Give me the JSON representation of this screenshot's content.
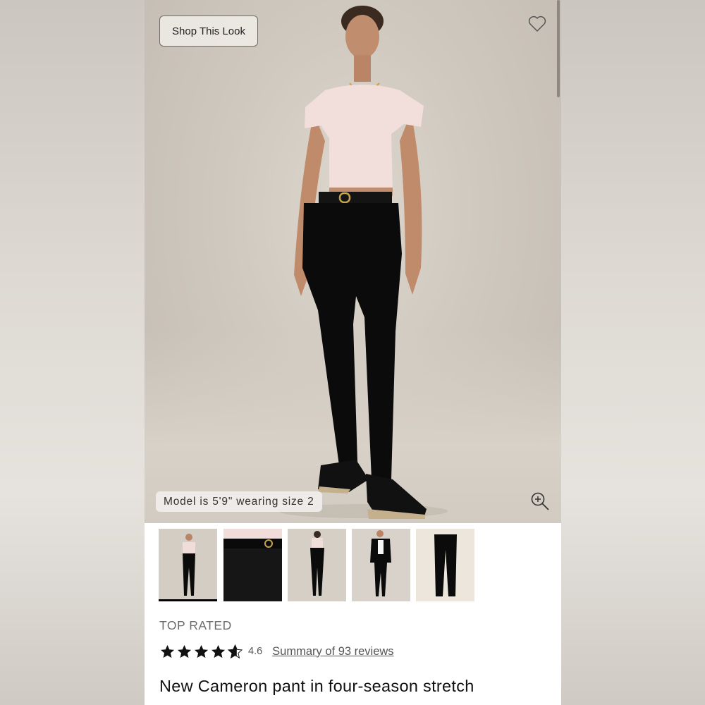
{
  "header": {
    "shop_this_look_label": "Shop This Look",
    "wishlist_icon": "heart-outline-icon"
  },
  "hero": {
    "model_caption": "Model is 5'9\" wearing size 2",
    "zoom_icon": "zoom-in-icon"
  },
  "thumbnails": [
    {
      "label": "full-body-front",
      "active": true
    },
    {
      "label": "waist-belt-detail",
      "active": false
    },
    {
      "label": "back-view",
      "active": false
    },
    {
      "label": "blazer-styled",
      "active": false
    },
    {
      "label": "flat-lay-pant",
      "active": false
    }
  ],
  "product": {
    "badge": "TOP RATED",
    "rating": "4.6",
    "reviews_link": "Summary of 93 reviews",
    "title": "New Cameron pant in four-season stretch",
    "stars_filled": 4.6,
    "stars_total": 5
  },
  "colors": {
    "text_primary": "#111111",
    "text_muted": "#6c6c6c",
    "star": "#111111"
  }
}
